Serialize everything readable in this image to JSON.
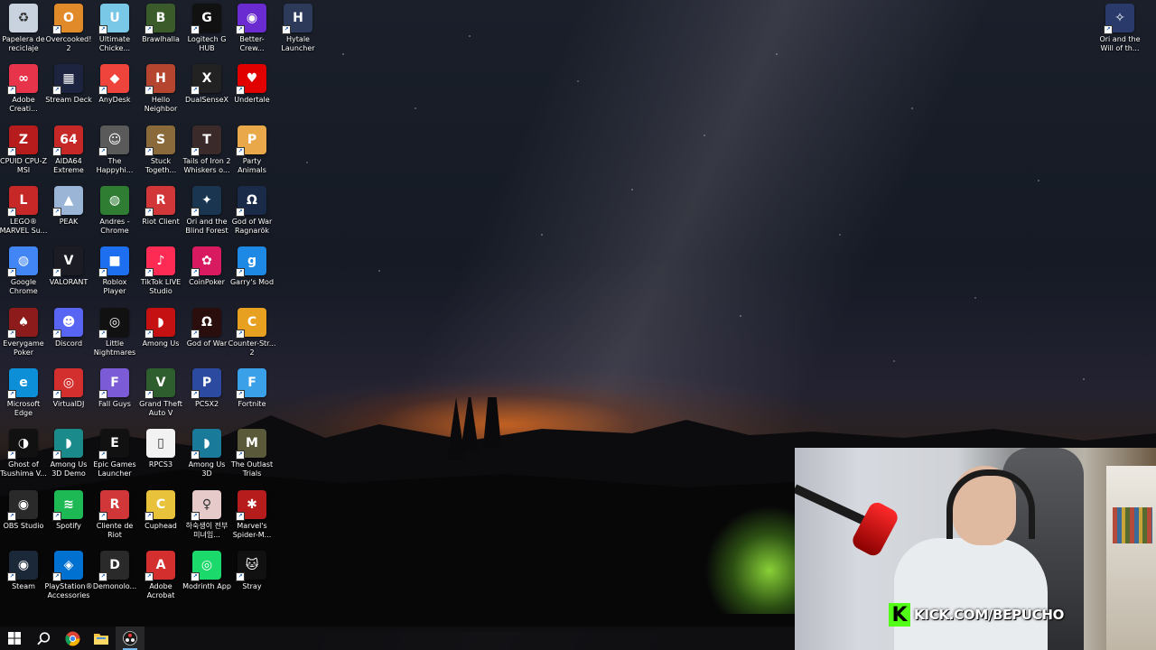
{
  "desktop": {
    "icons": [
      {
        "label": "Papelera de reciclaje",
        "icon": "recycle-bin-icon",
        "color": "#c8d3df",
        "glyph": "♻",
        "shortcut": false
      },
      {
        "label": "Overcooked! 2",
        "icon": "overcooked-icon",
        "color": "#e08a2a",
        "glyph": "O",
        "shortcut": true
      },
      {
        "label": "Ultimate Chicke...",
        "icon": "ultimate-chicken-horse-icon",
        "color": "#7ac8e8",
        "glyph": "U",
        "shortcut": true
      },
      {
        "label": "Brawlhalla",
        "icon": "brawlhalla-icon",
        "color": "#3b5c2a",
        "glyph": "B",
        "shortcut": true
      },
      {
        "label": "Logitech G HUB",
        "icon": "logitech-ghub-icon",
        "color": "#111111",
        "glyph": "G",
        "shortcut": true
      },
      {
        "label": "Better-Crew...",
        "icon": "better-crewlink-icon",
        "color": "#6a2bd1",
        "glyph": "◉",
        "shortcut": true
      },
      {
        "label": "Hytale Launcher",
        "icon": "hytale-icon",
        "color": "#2d3a5a",
        "glyph": "H",
        "shortcut": true
      },
      {
        "label": "Adobe Creati...",
        "icon": "adobe-creative-cloud-icon",
        "color": "#e8344a",
        "glyph": "∞",
        "shortcut": true
      },
      {
        "label": "Stream Deck",
        "icon": "stream-deck-icon",
        "color": "#1c2440",
        "glyph": "▦",
        "shortcut": true
      },
      {
        "label": "AnyDesk",
        "icon": "anydesk-icon",
        "color": "#ef443b",
        "glyph": "◆",
        "shortcut": true
      },
      {
        "label": "Hello Neighbor",
        "icon": "hello-neighbor-icon",
        "color": "#b5452e",
        "glyph": "H",
        "shortcut": true
      },
      {
        "label": "DualSenseX",
        "icon": "dualsensex-icon",
        "color": "#222222",
        "glyph": "X",
        "shortcut": true
      },
      {
        "label": "Undertale",
        "icon": "undertale-icon",
        "color": "#e00000",
        "glyph": "♥",
        "shortcut": true
      },
      {
        "label": "CPUID CPU-Z MSI",
        "icon": "cpuz-icon",
        "color": "#b71c1c",
        "glyph": "Z",
        "shortcut": true
      },
      {
        "label": "AIDA64 Extreme",
        "icon": "aida64-icon",
        "color": "#c62828",
        "glyph": "64",
        "shortcut": true
      },
      {
        "label": "The Happyhi...",
        "icon": "happyhills-icon",
        "color": "#5a5a5a",
        "glyph": "☺",
        "shortcut": true
      },
      {
        "label": "Stuck Togeth...",
        "icon": "stuck-together-icon",
        "color": "#8a6a3a",
        "glyph": "S",
        "shortcut": true
      },
      {
        "label": "Tails of Iron 2 Whiskers o...",
        "icon": "tails-of-iron-icon",
        "color": "#3a2a2a",
        "glyph": "T",
        "shortcut": true
      },
      {
        "label": "Party Animals",
        "icon": "party-animals-icon",
        "color": "#e9a94a",
        "glyph": "P",
        "shortcut": true
      },
      {
        "label": "LEGO® MARVEL Su...",
        "icon": "lego-marvel-icon",
        "color": "#c62828",
        "glyph": "L",
        "shortcut": true
      },
      {
        "label": "PEAK",
        "icon": "peak-icon",
        "color": "#9ab5d6",
        "glyph": "▲",
        "shortcut": true
      },
      {
        "label": "Andres - Chrome",
        "icon": "chrome-profile-icon",
        "color": "#2e7d32",
        "glyph": "◍",
        "shortcut": false
      },
      {
        "label": "Riot Client",
        "icon": "riot-client-icon",
        "color": "#d13639",
        "glyph": "R",
        "shortcut": true
      },
      {
        "label": "Ori and the Blind Forest",
        "icon": "ori-blind-forest-icon",
        "color": "#1a3550",
        "glyph": "✦",
        "shortcut": true
      },
      {
        "label": "God of War Ragnarök",
        "icon": "god-of-war-ragnarok-icon",
        "color": "#1a2b4a",
        "glyph": "Ω",
        "shortcut": true
      },
      {
        "label": "Google Chrome",
        "icon": "google-chrome-icon",
        "color": "#4285f4",
        "glyph": "◍",
        "shortcut": true
      },
      {
        "label": "VALORANT",
        "icon": "valorant-icon",
        "color": "#1c1c24",
        "glyph": "V",
        "shortcut": true
      },
      {
        "label": "Roblox Player",
        "icon": "roblox-icon",
        "color": "#1e6ff0",
        "glyph": "■",
        "shortcut": true
      },
      {
        "label": "TikTok LIVE Studio",
        "icon": "tiktok-live-icon",
        "color": "#fe2c55",
        "glyph": "♪",
        "shortcut": true
      },
      {
        "label": "CoinPoker",
        "icon": "coinpoker-icon",
        "color": "#d81b60",
        "glyph": "✿",
        "shortcut": true
      },
      {
        "label": "Garry's Mod",
        "icon": "garrys-mod-icon",
        "color": "#1e88e5",
        "glyph": "g",
        "shortcut": true
      },
      {
        "label": "Everygame Poker",
        "icon": "everygame-poker-icon",
        "color": "#8e1b1b",
        "glyph": "♠",
        "shortcut": true
      },
      {
        "label": "Discord",
        "icon": "discord-icon",
        "color": "#5865f2",
        "glyph": "☻",
        "shortcut": true
      },
      {
        "label": "Little Nightmares",
        "icon": "little-nightmares-icon",
        "color": "#111111",
        "glyph": "◎",
        "shortcut": true
      },
      {
        "label": "Among Us",
        "icon": "among-us-icon",
        "color": "#c51111",
        "glyph": "◗",
        "shortcut": true
      },
      {
        "label": "God of War",
        "icon": "god-of-war-icon",
        "color": "#2a0e0e",
        "glyph": "Ω",
        "shortcut": true
      },
      {
        "label": "Counter-Str... 2",
        "icon": "counter-strike-2-icon",
        "color": "#e8a020",
        "glyph": "C",
        "shortcut": true
      },
      {
        "label": "Microsoft Edge",
        "icon": "microsoft-edge-icon",
        "color": "#0c8fd6",
        "glyph": "e",
        "shortcut": true
      },
      {
        "label": "VirtualDJ",
        "icon": "virtualdj-icon",
        "color": "#d32f2f",
        "glyph": "◎",
        "shortcut": true
      },
      {
        "label": "Fall Guys",
        "icon": "fall-guys-icon",
        "color": "#7b5cd6",
        "glyph": "F",
        "shortcut": true
      },
      {
        "label": "Grand Theft Auto V",
        "icon": "gta-v-icon",
        "color": "#2e5e2e",
        "glyph": "V",
        "shortcut": true
      },
      {
        "label": "PCSX2",
        "icon": "pcsx2-icon",
        "color": "#2b4aa0",
        "glyph": "P",
        "shortcut": true
      },
      {
        "label": "Fortnite",
        "icon": "fortnite-icon",
        "color": "#3aa0e8",
        "glyph": "F",
        "shortcut": true
      },
      {
        "label": "Ghost of Tsushima V...",
        "icon": "ghost-of-tsushima-icon",
        "color": "#111111",
        "glyph": "◑",
        "shortcut": true
      },
      {
        "label": "Among Us 3D Demo",
        "icon": "among-us-3d-demo-icon",
        "color": "#1a8a8a",
        "glyph": "◗",
        "shortcut": true
      },
      {
        "label": "Epic Games Launcher",
        "icon": "epic-games-icon",
        "color": "#111111",
        "glyph": "E",
        "shortcut": true
      },
      {
        "label": "RPCS3",
        "icon": "rpcs3-icon",
        "color": "#f2f2f2",
        "glyph": "▯",
        "shortcut": false
      },
      {
        "label": "Among Us 3D",
        "icon": "among-us-3d-icon",
        "color": "#1a7a9a",
        "glyph": "◗",
        "shortcut": true
      },
      {
        "label": "The Outlast Trials",
        "icon": "outlast-trials-icon",
        "color": "#5a5a3a",
        "glyph": "M",
        "shortcut": true
      },
      {
        "label": "OBS Studio",
        "icon": "obs-studio-icon",
        "color": "#2a2a2a",
        "glyph": "◉",
        "shortcut": true
      },
      {
        "label": "Spotify",
        "icon": "spotify-icon",
        "color": "#1db954",
        "glyph": "≋",
        "shortcut": true
      },
      {
        "label": "Cliente de Riot",
        "icon": "riot-client-es-icon",
        "color": "#d13639",
        "glyph": "R",
        "shortcut": true
      },
      {
        "label": "Cuphead",
        "icon": "cuphead-icon",
        "color": "#e8c23a",
        "glyph": "C",
        "shortcut": true
      },
      {
        "label": "하숙생이 전부 미녀임...",
        "icon": "korean-game-icon",
        "color": "#e6c9c9",
        "glyph": "♀",
        "shortcut": true
      },
      {
        "label": "Marvel's Spider-M...",
        "icon": "spider-man-icon",
        "color": "#b71c1c",
        "glyph": "✱",
        "shortcut": true
      },
      {
        "label": "Steam",
        "icon": "steam-icon",
        "color": "#1b2838",
        "glyph": "◉",
        "shortcut": true
      },
      {
        "label": "PlayStation® Accessories",
        "icon": "playstation-accessories-icon",
        "color": "#0070d1",
        "glyph": "◈",
        "shortcut": true
      },
      {
        "label": "Demonolo...",
        "icon": "demonologist-icon",
        "color": "#2a2a2a",
        "glyph": "D",
        "shortcut": true
      },
      {
        "label": "Adobe Acrobat",
        "icon": "adobe-acrobat-icon",
        "color": "#d32f2f",
        "glyph": "A",
        "shortcut": true
      },
      {
        "label": "Modrinth App",
        "icon": "modrinth-icon",
        "color": "#1bd96a",
        "glyph": "◎",
        "shortcut": true
      },
      {
        "label": "Stray",
        "icon": "stray-icon",
        "color": "#111111",
        "glyph": "🐱",
        "shortcut": true
      },
      {
        "label": "Ori and the Will of th...",
        "icon": "ori-will-of-wisps-icon",
        "color": "#2a3a6a",
        "glyph": "✧",
        "shortcut": true
      }
    ]
  },
  "webcam": {
    "overlay_text": "KICK.COM/BEPUCHO",
    "logo_letter": "K",
    "brand_color": "#53fc18"
  },
  "taskbar": {
    "items": [
      {
        "icon": "windows-start-icon",
        "active": false
      },
      {
        "icon": "search-icon",
        "active": false
      },
      {
        "icon": "google-chrome-icon",
        "active": false
      },
      {
        "icon": "file-explorer-icon",
        "active": false
      },
      {
        "icon": "obs-studio-icon",
        "active": true
      }
    ]
  }
}
